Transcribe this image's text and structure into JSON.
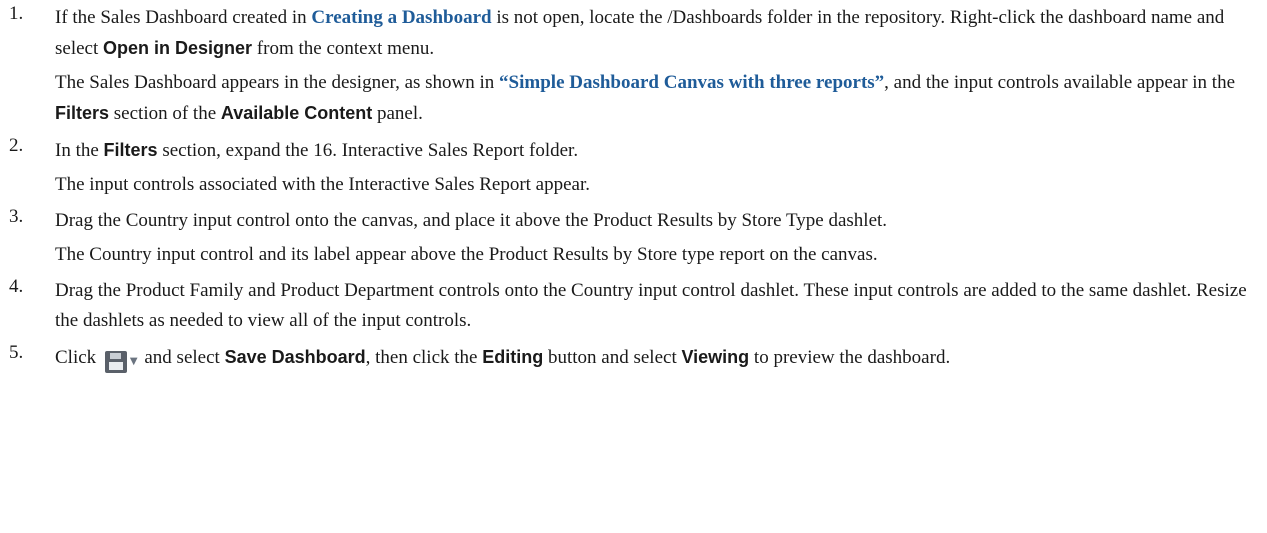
{
  "steps": [
    {
      "number": "1.",
      "a": "If the Sales Dashboard created in ",
      "link": "Creating a Dashboard",
      "b": " is not open, locate the /Dashboards folder in the repository. Right-click the dashboard name and select ",
      "bold1": "Open in Designer",
      "c": " from the context menu.",
      "result": {
        "a": "The Sales Dashboard appears in the designer, as shown in ",
        "link": "“Simple Dashboard Canvas with three reports”",
        "b": ", and the input controls available appear in the ",
        "bold1": "Filters",
        "c": " section of the ",
        "bold2": "Available Content",
        "d": " panel."
      }
    },
    {
      "number": "2.",
      "a": "In the ",
      "bold1": "Filters",
      "b": " section, expand the 16. Interactive Sales Report folder.",
      "result": "The input controls associated with the Interactive Sales Report appear."
    },
    {
      "number": "3.",
      "text": "Drag the Country input control onto the canvas, and place it above the Product Results by Store Type dashlet.",
      "result": "The Country input control and its label appear above the Product Results by Store type report on the canvas."
    },
    {
      "number": "4.",
      "text": "Drag the Product Family and Product Department controls onto the Country input control dashlet. These input controls are added to the same dashlet. Resize the dashlets as needed to view all of the input controls."
    },
    {
      "number": "5.",
      "a": "Click ",
      "save_icon": "save-icon",
      "caret_icon": "caret-down-icon",
      "b": " and select ",
      "bold1": "Save Dashboard",
      "c": ", then click the ",
      "bold2": "Editing",
      "d": " button and select ",
      "bold3": "Viewing",
      "e": " to preview the dashboard."
    }
  ],
  "colors": {
    "link": "#1f5c99",
    "text": "#1a1a1a",
    "icon": "#5a6069"
  }
}
